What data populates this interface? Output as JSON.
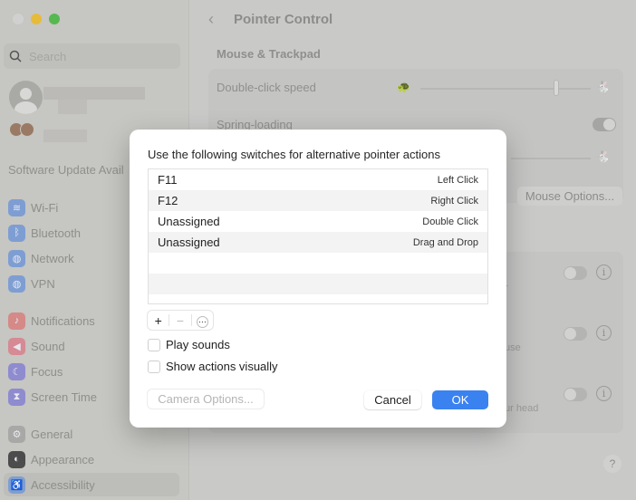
{
  "sidebar": {
    "search_placeholder": "Search",
    "software_update": "Software Update Avail",
    "items": [
      {
        "label": "Wi-Fi",
        "icon": "wifi-icon",
        "color": "#7e9ed3",
        "glyph": "≋"
      },
      {
        "label": "Bluetooth",
        "icon": "bluetooth-icon",
        "color": "#7e9ed3",
        "glyph": "ᛒ"
      },
      {
        "label": "Network",
        "icon": "globe-icon",
        "color": "#7e9ed3",
        "glyph": "◍"
      },
      {
        "label": "VPN",
        "icon": "vpn-icon",
        "color": "#7e9ed3",
        "glyph": "◍"
      },
      {
        "label": "Notifications",
        "icon": "bell-icon",
        "color": "#d58a88",
        "glyph": "♪"
      },
      {
        "label": "Sound",
        "icon": "speaker-icon",
        "color": "#d58a94",
        "glyph": "◀"
      },
      {
        "label": "Focus",
        "icon": "moon-icon",
        "color": "#8f8bcf",
        "glyph": "☾"
      },
      {
        "label": "Screen Time",
        "icon": "hourglass-icon",
        "color": "#8f8bcf",
        "glyph": "⧗"
      },
      {
        "label": "General",
        "icon": "gear-icon",
        "color": "#a8a8a6",
        "glyph": "⚙"
      },
      {
        "label": "Appearance",
        "icon": "appearance-icon",
        "color": "#4c4c4c",
        "glyph": "◐"
      },
      {
        "label": "Accessibility",
        "icon": "accessibility-icon",
        "color": "#7e9ed3",
        "glyph": "♿"
      }
    ],
    "active": "Accessibility"
  },
  "main": {
    "title": "Pointer Control",
    "section": "Mouse & Trackpad",
    "double_click_label": "Double-click speed",
    "double_click_value": 0.8,
    "spring_loading_label": "Spring-loading",
    "spring_loading_on": true,
    "mouse_options": "Mouse Options...",
    "partial_texts": [
      "r",
      "use",
      "ur head"
    ],
    "help": "?"
  },
  "dialog": {
    "title": "Use the following switches for alternative pointer actions",
    "rows": [
      {
        "switch": "F11",
        "action": "Left Click"
      },
      {
        "switch": "F12",
        "action": "Right Click"
      },
      {
        "switch": "Unassigned",
        "action": "Double Click"
      },
      {
        "switch": "Unassigned",
        "action": "Drag and Drop"
      }
    ],
    "add": "+",
    "remove": "−",
    "more": "⋯",
    "play_sounds": "Play sounds",
    "play_sounds_checked": false,
    "show_actions": "Show actions visually",
    "show_actions_checked": false,
    "camera_options": "Camera Options...",
    "cancel": "Cancel",
    "ok": "OK"
  }
}
